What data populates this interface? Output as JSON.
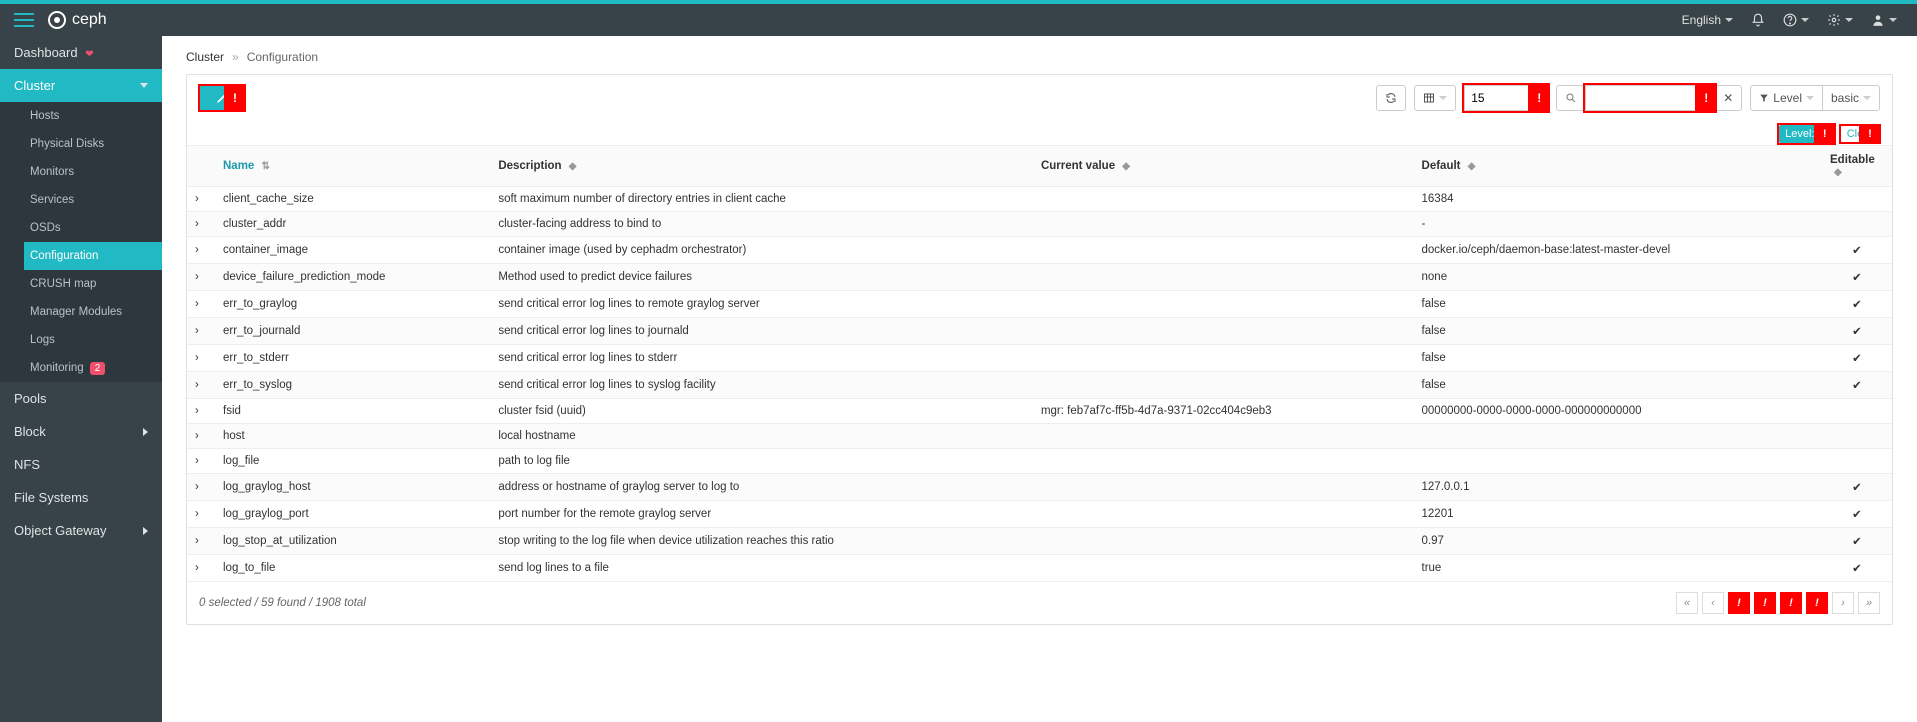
{
  "brand": "ceph",
  "topnav": {
    "language": "English"
  },
  "sidebar": {
    "items": [
      {
        "label": "Dashboard",
        "kind": "top",
        "heart": true
      },
      {
        "label": "Cluster",
        "kind": "section",
        "expanded": true,
        "children": [
          {
            "label": "Hosts"
          },
          {
            "label": "Physical Disks"
          },
          {
            "label": "Monitors"
          },
          {
            "label": "Services"
          },
          {
            "label": "OSDs"
          },
          {
            "label": "Configuration",
            "active": true
          },
          {
            "label": "CRUSH map"
          },
          {
            "label": "Manager Modules"
          },
          {
            "label": "Logs"
          },
          {
            "label": "Monitoring",
            "badge": "2"
          }
        ]
      },
      {
        "label": "Pools",
        "kind": "top"
      },
      {
        "label": "Block",
        "kind": "top",
        "chevron": true
      },
      {
        "label": "NFS",
        "kind": "top"
      },
      {
        "label": "File Systems",
        "kind": "top"
      },
      {
        "label": "Object Gateway",
        "kind": "top",
        "chevron": true
      }
    ]
  },
  "breadcrumb": {
    "root": "Cluster",
    "current": "Configuration"
  },
  "toolbar": {
    "page_size": "15",
    "search_value": "",
    "filter_label": "Level",
    "filter_value": "basic"
  },
  "tags": {
    "level_prefix": "Level:",
    "clear": "Clear"
  },
  "table": {
    "columns": [
      "Name",
      "Description",
      "Current value",
      "Default",
      "Editable"
    ],
    "rows": [
      {
        "name": "client_cache_size",
        "desc": "soft maximum number of directory entries in client cache",
        "cur": "",
        "def": "16384",
        "editable": false
      },
      {
        "name": "cluster_addr",
        "desc": "cluster-facing address to bind to",
        "cur": "",
        "def": "-",
        "editable": false
      },
      {
        "name": "container_image",
        "desc": "container image (used by cephadm orchestrator)",
        "cur": "",
        "def": "docker.io/ceph/daemon-base:latest-master-devel",
        "editable": true
      },
      {
        "name": "device_failure_prediction_mode",
        "desc": "Method used to predict device failures",
        "cur": "",
        "def": "none",
        "editable": true
      },
      {
        "name": "err_to_graylog",
        "desc": "send critical error log lines to remote graylog server",
        "cur": "",
        "def": "false",
        "editable": true
      },
      {
        "name": "err_to_journald",
        "desc": "send critical error log lines to journald",
        "cur": "",
        "def": "false",
        "editable": true
      },
      {
        "name": "err_to_stderr",
        "desc": "send critical error log lines to stderr",
        "cur": "",
        "def": "false",
        "editable": true
      },
      {
        "name": "err_to_syslog",
        "desc": "send critical error log lines to syslog facility",
        "cur": "",
        "def": "false",
        "editable": true
      },
      {
        "name": "fsid",
        "desc": "cluster fsid (uuid)",
        "cur": "mgr: feb7af7c-ff5b-4d7a-9371-02cc404c9eb3",
        "def": "00000000-0000-0000-0000-000000000000",
        "editable": false
      },
      {
        "name": "host",
        "desc": "local hostname",
        "cur": "",
        "def": "",
        "editable": false
      },
      {
        "name": "log_file",
        "desc": "path to log file",
        "cur": "",
        "def": "",
        "editable": false
      },
      {
        "name": "log_graylog_host",
        "desc": "address or hostname of graylog server to log to",
        "cur": "",
        "def": "127.0.0.1",
        "editable": true
      },
      {
        "name": "log_graylog_port",
        "desc": "port number for the remote graylog server",
        "cur": "",
        "def": "12201",
        "editable": true
      },
      {
        "name": "log_stop_at_utilization",
        "desc": "stop writing to the log file when device utilization reaches this ratio",
        "cur": "",
        "def": "0.97",
        "editable": true
      },
      {
        "name": "log_to_file",
        "desc": "send log lines to a file",
        "cur": "",
        "def": "true",
        "editable": true
      }
    ]
  },
  "footer": {
    "text": "0 selected / 59 found / 1908 total"
  }
}
